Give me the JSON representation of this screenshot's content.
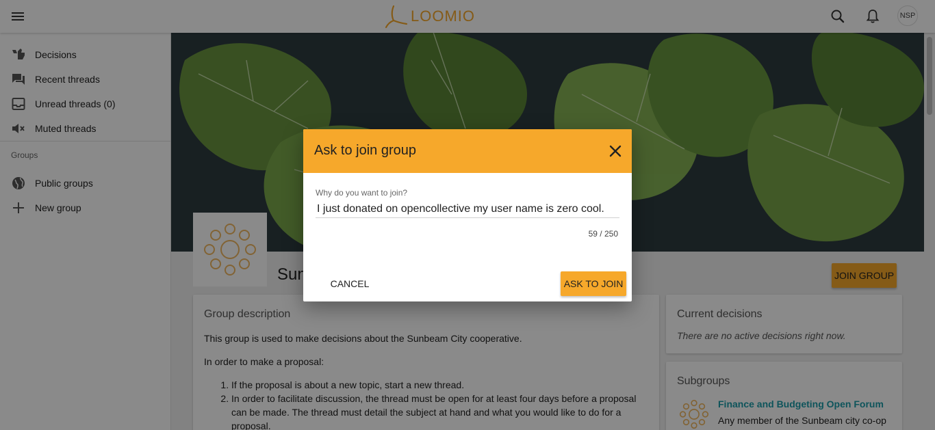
{
  "topbar": {
    "logo_text": "LOOMIO",
    "avatar_initials": "NSP",
    "icons": [
      "menu-icon",
      "search-icon",
      "bell-icon"
    ]
  },
  "sidebar": {
    "items": [
      {
        "label": "Decisions",
        "icon": "thumbs-icon"
      },
      {
        "label": "Recent threads",
        "icon": "forum-icon"
      },
      {
        "label": "Unread threads (0)",
        "icon": "inbox-icon"
      },
      {
        "label": "Muted threads",
        "icon": "mute-icon"
      }
    ],
    "groups_heading": "Groups",
    "group_items": [
      {
        "label": "Public groups",
        "icon": "globe-icon"
      },
      {
        "label": "New group",
        "icon": "plus-icon"
      }
    ]
  },
  "group": {
    "title": "Sun",
    "join_label": "JOIN GROUP"
  },
  "description": {
    "title": "Group description",
    "intro": "This group is used to make decisions about the Sunbeam City cooperative.",
    "proposal_intro": "In order to make a proposal:",
    "steps": [
      "If the proposal is about a new topic, start a new thread.",
      "In order to facilitate discussion, the thread must be open for at least four days before a proposal can be made. The thread must detail the subject at hand and what you would like to do for a proposal."
    ]
  },
  "decisions": {
    "title": "Current decisions",
    "empty_text": "There are no active decisions right now."
  },
  "subgroups": {
    "title": "Subgroups",
    "first_name": "Finance and Budgeting Open Forum",
    "first_desc": "Any member of the Sunbeam city co-op can join this subgroup. Idea and"
  },
  "modal": {
    "title": "Ask to join group",
    "field_label": "Why do you want to join?",
    "field_value": "I just donated on opencollective my user name is zero cool.",
    "counter": "59 / 250",
    "cancel_label": "CANCEL",
    "submit_label": "ASK TO JOIN"
  },
  "colors": {
    "accent": "#f6a82b",
    "link": "#1a9ba8"
  }
}
